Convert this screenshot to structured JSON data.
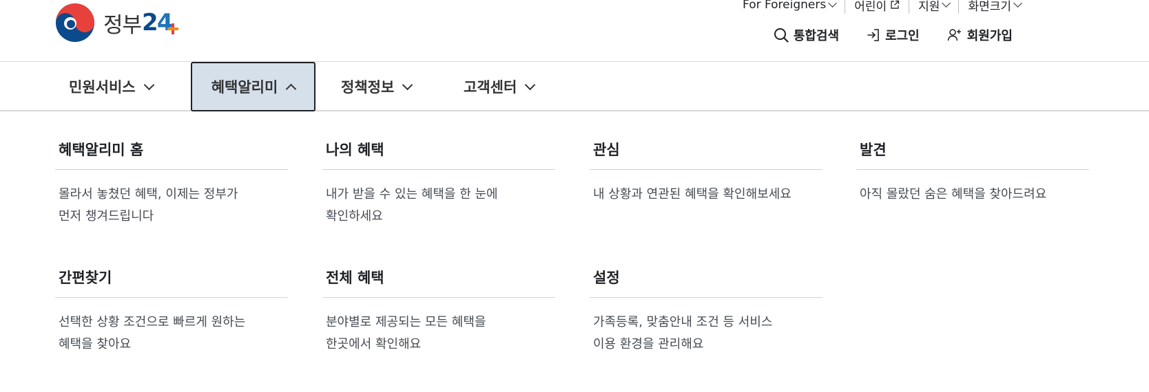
{
  "brand": {
    "name": "정부",
    "number_2": "2",
    "number_4": "4"
  },
  "utility": [
    {
      "label": "For Foreigners",
      "icon": "chevron-down-icon"
    },
    {
      "label": "어린이",
      "icon": "external-link-icon"
    },
    {
      "label": "지원",
      "icon": "chevron-down-icon"
    },
    {
      "label": "화면크기",
      "icon": "chevron-down-icon"
    }
  ],
  "actions": {
    "search": "통합검색",
    "login": "로그인",
    "signup": "회원가입"
  },
  "gnb": [
    {
      "label": "민원서비스"
    },
    {
      "label": "혜택알리미"
    },
    {
      "label": "정책정보"
    },
    {
      "label": "고객센터"
    }
  ],
  "menu": [
    {
      "title": "혜택알리미 홈",
      "desc1": "몰라서 놓쳤던 혜택, 이제는 정부가",
      "desc2": "먼저 챙겨드립니다"
    },
    {
      "title": "나의 혜택",
      "desc1": "내가 받을 수 있는 혜택을 한 눈에",
      "desc2": "확인하세요"
    },
    {
      "title": "관심",
      "desc1": "내 상황과 연관된 혜택을 확인해보세요",
      "desc2": ""
    },
    {
      "title": "발견",
      "desc1": "아직 몰랐던 숨은 혜택을 찾아드려요",
      "desc2": ""
    },
    {
      "title": "간편찾기",
      "desc1": "선택한 상황 조건으로 빠르게 원하는",
      "desc2": "혜택을 찾아요"
    },
    {
      "title": "전체 혜택",
      "desc1": "분야별로 제공되는 모든 혜택을",
      "desc2": "한곳에서 확인해요"
    },
    {
      "title": "설정",
      "desc1": "가족등록, 맞춤안내 조건 등 서비스",
      "desc2": "이용 환경을 관리해요"
    }
  ],
  "colors": {
    "active_bg": "#d6e0eb",
    "logo_red": "#e8413c",
    "logo_blue": "#0b4a8c",
    "logo_orange": "#f08c1a"
  }
}
